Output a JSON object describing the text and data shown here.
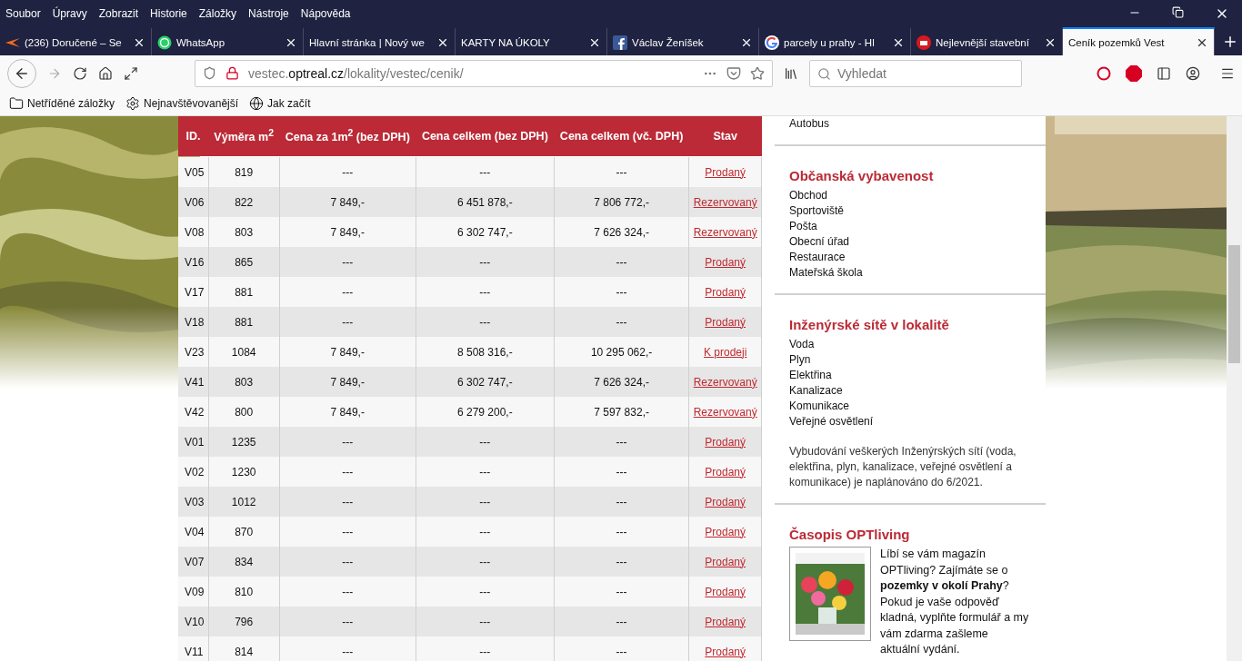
{
  "menu_bar": [
    "Soubor",
    "Úpravy",
    "Zobrazit",
    "Historie",
    "Záložky",
    "Nástroje",
    "Nápověda"
  ],
  "tabs": [
    {
      "kind": "mail",
      "title": "(236) Doručené – Se",
      "selected": false
    },
    {
      "kind": "chat",
      "title": "WhatsApp",
      "selected": false
    },
    {
      "kind": "plain",
      "title": "Hlavní stránka | Nový we",
      "selected": false
    },
    {
      "kind": "plain",
      "title": "KARTY NA ÚKOLY",
      "selected": false
    },
    {
      "kind": "social",
      "title": "Václav Ženíšek",
      "selected": false
    },
    {
      "kind": "search",
      "title": "parcely u prahy - Hl",
      "selected": false
    },
    {
      "kind": "badge",
      "title": "Nejlevnější stavební",
      "selected": false
    },
    {
      "kind": "plain",
      "title": "Ceník pozemků Vest",
      "selected": true
    }
  ],
  "address": {
    "host_prefix": "vestec.",
    "domain": "optreal.cz",
    "path": "/lokality/vestec/cenik/"
  },
  "search": {
    "placeholder": "Vyhledat"
  },
  "bookmarks": [
    {
      "kind": "folder",
      "label": "Netříděné záložky"
    },
    {
      "kind": "gear",
      "label": "Nejnavštěvovanější"
    },
    {
      "kind": "globe",
      "label": "Jak začít"
    }
  ],
  "table": {
    "columns": [
      "ID.",
      "Výměra m$^{2}$",
      "Cena za 1m$^{2}$ (bez DPH)",
      "Cena celkem (bez DPH)",
      "Cena celkem (vč. DPH)",
      "Stav"
    ],
    "rows": [
      [
        "V05",
        "819",
        "---",
        "---",
        "---",
        "Prodaný"
      ],
      [
        "V06",
        "822",
        "7 849,-",
        "6 451 878,-",
        "7 806 772,-",
        "Rezervovaný"
      ],
      [
        "V08",
        "803",
        "7 849,-",
        "6 302 747,-",
        "7 626 324,-",
        "Rezervovaný"
      ],
      [
        "V16",
        "865",
        "---",
        "---",
        "---",
        "Prodaný"
      ],
      [
        "V17",
        "881",
        "---",
        "---",
        "---",
        "Prodaný"
      ],
      [
        "V18",
        "881",
        "---",
        "---",
        "---",
        "Prodaný"
      ],
      [
        "V23",
        "1084",
        "7 849,-",
        "8 508 316,-",
        "10 295 062,-",
        "K prodeji"
      ],
      [
        "V41",
        "803",
        "7 849,-",
        "6 302 747,-",
        "7 626 324,-",
        "Rezervovaný"
      ],
      [
        "V42",
        "800",
        "7 849,-",
        "6 279 200,-",
        "7 597 832,-",
        "Rezervovaný"
      ],
      [
        "V01",
        "1235",
        "---",
        "---",
        "---",
        "Prodaný"
      ],
      [
        "V02",
        "1230",
        "---",
        "---",
        "---",
        "Prodaný"
      ],
      [
        "V03",
        "1012",
        "---",
        "---",
        "---",
        "Prodaný"
      ],
      [
        "V04",
        "870",
        "---",
        "---",
        "---",
        "Prodaný"
      ],
      [
        "V07",
        "834",
        "---",
        "---",
        "---",
        "Prodaný"
      ],
      [
        "V09",
        "810",
        "---",
        "---",
        "---",
        "Prodaný"
      ],
      [
        "V10",
        "796",
        "---",
        "---",
        "---",
        "Prodaný"
      ],
      [
        "V11",
        "814",
        "---",
        "---",
        "---",
        "Prodaný"
      ]
    ]
  },
  "sidebar": [
    {
      "items": [
        "Autobus"
      ]
    },
    {
      "title": "Občanská vybavenost",
      "items": [
        "Obchod",
        "Sportoviště",
        "Pošta",
        "Obecní úřad",
        "Restaurace",
        "Mateřská škola"
      ]
    },
    {
      "title": "Inženýrské sítě v lokalitě",
      "items": [
        "Voda",
        "Plyn",
        "Elektřina",
        "Kanalizace",
        "Komunikace",
        "Veřejné osvětlení"
      ],
      "note": "Vybudování veškerých Inženýrských sítí (voda, elektřina, plyn, kanalizace, veřejné osvětlení a komunikace) je naplánováno do 6/2021."
    },
    {
      "title": "Časopis OPTliving",
      "note": "Líbí se vám magazín OPTliving? Zajímáte se o **pozemky v okolí Prahy**? Pokud je vaše odpověď kladná, vyplňte formulář a my vám zdarma zašleme aktuální vydání."
    }
  ]
}
